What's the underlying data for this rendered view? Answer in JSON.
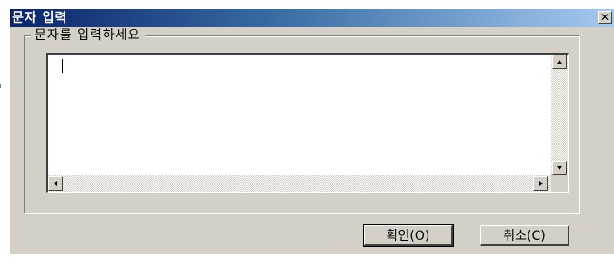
{
  "dialog": {
    "title": "문자 입력",
    "close_glyph": "✕",
    "group_label": "문자를 입력하세요",
    "input": {
      "value": "",
      "placeholder": ""
    },
    "buttons": {
      "ok_label": "확인(O)",
      "cancel_label": "취소(C)"
    }
  },
  "colors": {
    "titlebar_start": "#0a246a",
    "titlebar_end": "#a6caf0",
    "face": "#d4d0c8"
  }
}
